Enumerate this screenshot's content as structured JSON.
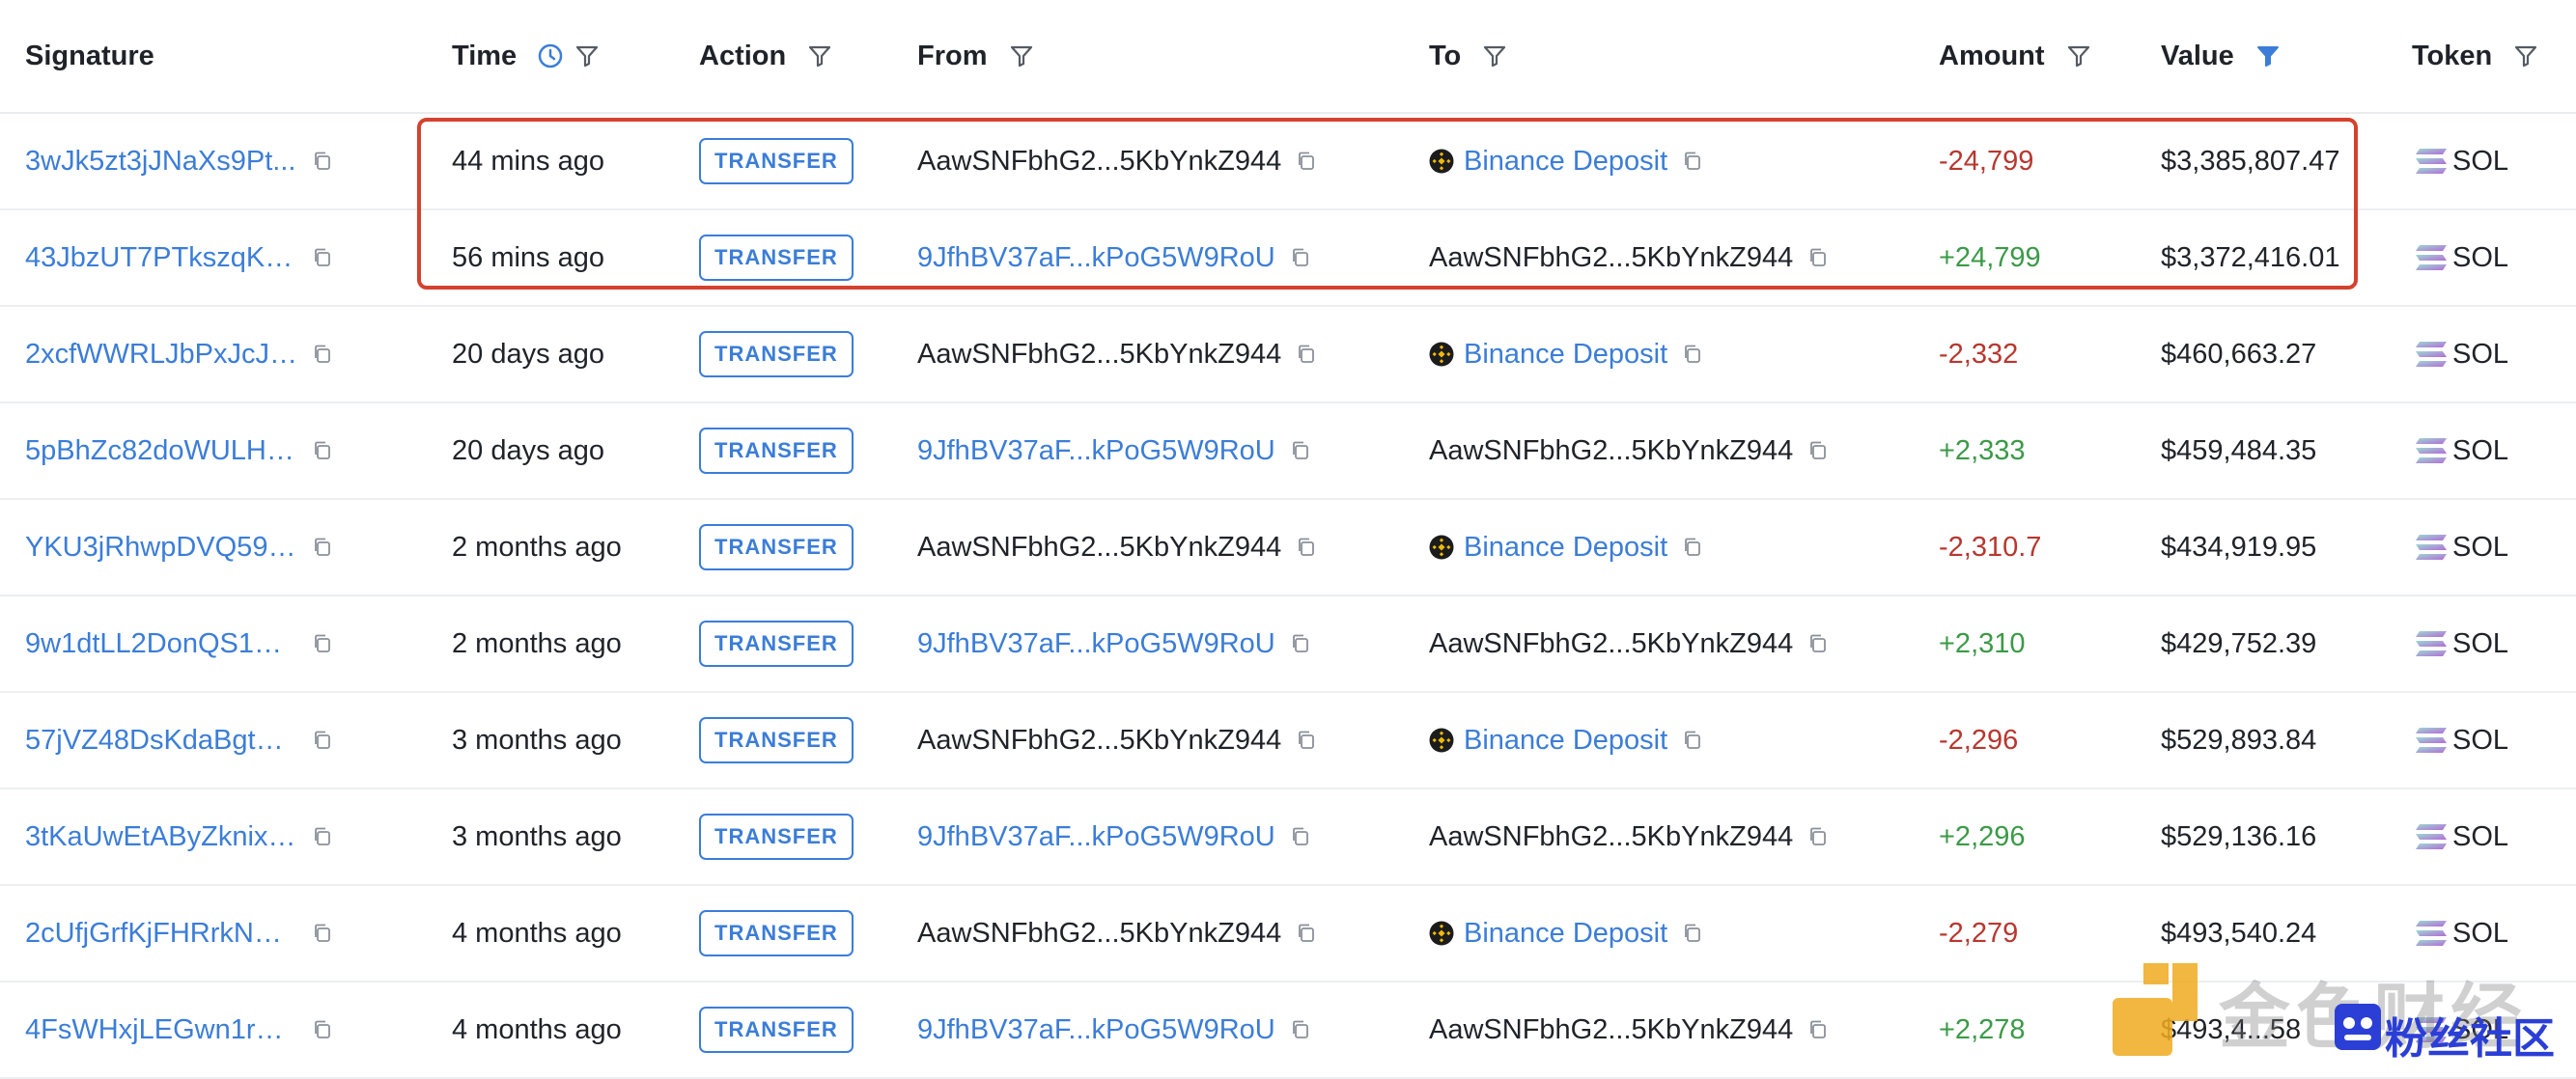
{
  "headers": {
    "signature": "Signature",
    "time": "Time",
    "action": "Action",
    "from": "From",
    "to": "To",
    "amount": "Amount",
    "value": "Value",
    "token": "Token"
  },
  "colors": {
    "link": "#3b7dd8",
    "negative": "#b8372f",
    "positive": "#3b9a47",
    "highlight": "#d4422e",
    "active_filter": "#3b7dd8"
  },
  "rows": [
    {
      "signature": "3wJk5zt3jJNaXs9Pt...",
      "time": "44 mins ago",
      "action": "TRANSFER",
      "from": "AawSNFbhG2...5KbYnkZ944",
      "from_link": false,
      "to": "Binance Deposit",
      "to_link": true,
      "amount": "-24,799",
      "value": "$3,385,807.47",
      "token": "SOL"
    },
    {
      "signature": "43JbzUT7PTkszqKF...",
      "time": "56 mins ago",
      "action": "TRANSFER",
      "from": "9JfhBV37aF...kPoG5W9RoU",
      "from_link": true,
      "to": "AawSNFbhG2...5KbYnkZ944",
      "to_link": false,
      "amount": "+24,799",
      "value": "$3,372,416.01",
      "token": "SOL"
    },
    {
      "signature": "2xcfWWRLJbPxJcJq...",
      "time": "20 days ago",
      "action": "TRANSFER",
      "from": "AawSNFbhG2...5KbYnkZ944",
      "from_link": false,
      "to": "Binance Deposit",
      "to_link": true,
      "amount": "-2,332",
      "value": "$460,663.27",
      "token": "SOL"
    },
    {
      "signature": "5pBhZc82doWULH9...",
      "time": "20 days ago",
      "action": "TRANSFER",
      "from": "9JfhBV37aF...kPoG5W9RoU",
      "from_link": true,
      "to": "AawSNFbhG2...5KbYnkZ944",
      "to_link": false,
      "amount": "+2,333",
      "value": "$459,484.35",
      "token": "SOL"
    },
    {
      "signature": "YKU3jRhwpDVQ59ER...",
      "time": "2 months ago",
      "action": "TRANSFER",
      "from": "AawSNFbhG2...5KbYnkZ944",
      "from_link": false,
      "to": "Binance Deposit",
      "to_link": true,
      "amount": "-2,310.7",
      "value": "$434,919.95",
      "token": "SOL"
    },
    {
      "signature": "9w1dtLL2DonQS1nt...",
      "time": "2 months ago",
      "action": "TRANSFER",
      "from": "9JfhBV37aF...kPoG5W9RoU",
      "from_link": true,
      "to": "AawSNFbhG2...5KbYnkZ944",
      "to_link": false,
      "amount": "+2,310",
      "value": "$429,752.39",
      "token": "SOL"
    },
    {
      "signature": "57jVZ48DsKdaBgtBL...",
      "time": "3 months ago",
      "action": "TRANSFER",
      "from": "AawSNFbhG2...5KbYnkZ944",
      "from_link": false,
      "to": "Binance Deposit",
      "to_link": true,
      "amount": "-2,296",
      "value": "$529,893.84",
      "token": "SOL"
    },
    {
      "signature": "3tKaUwEtAByZknixv...",
      "time": "3 months ago",
      "action": "TRANSFER",
      "from": "9JfhBV37aF...kPoG5W9RoU",
      "from_link": true,
      "to": "AawSNFbhG2...5KbYnkZ944",
      "to_link": false,
      "amount": "+2,296",
      "value": "$529,136.16",
      "token": "SOL"
    },
    {
      "signature": "2cUfjGrfKjFHRrkNZ5j...",
      "time": "4 months ago",
      "action": "TRANSFER",
      "from": "AawSNFbhG2...5KbYnkZ944",
      "from_link": false,
      "to": "Binance Deposit",
      "to_link": true,
      "amount": "-2,279",
      "value": "$493,540.24",
      "token": "SOL"
    },
    {
      "signature": "4FsWHxjLEGwn1rhN...",
      "time": "4 months ago",
      "action": "TRANSFER",
      "from": "9JfhBV37aF...kPoG5W9RoU",
      "from_link": true,
      "to": "AawSNFbhG2...5KbYnkZ944",
      "to_link": false,
      "amount": "+2,278",
      "value": "$493,4...58",
      "token": "SOL"
    }
  ],
  "watermark": {
    "main": "金色财经",
    "sub": "粉丝社区"
  }
}
